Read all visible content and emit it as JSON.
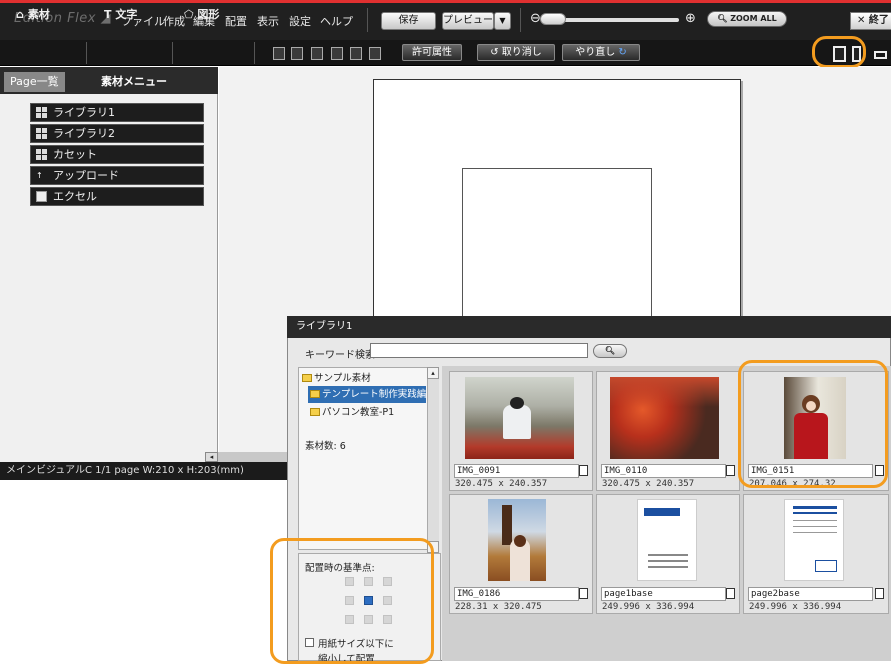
{
  "app": {
    "title": "Edition Flex ◢",
    "menu": [
      "ファイル",
      "作成",
      "編集",
      "配置",
      "表示",
      "設定",
      "ヘルプ"
    ],
    "save_label": "保存",
    "preview_label": "プレビュー",
    "preview_arrow": "▼",
    "zoom_minus": "⊖",
    "zoom_plus": "⊕",
    "zoom_all_label": "ZOOM ALL",
    "close_label": "✕ 終了"
  },
  "toolbar": {
    "sozai_label": "素材",
    "text_label": "文字",
    "shape_label": "図形",
    "permission_label": "許可属性",
    "undo_label": "取り消し",
    "redo_label": "やり直し"
  },
  "left_panel": {
    "tabs": [
      "Page一覧",
      "素材メニュー"
    ],
    "items": [
      "ライブラリ1",
      "ライブラリ2",
      "カセット",
      "アップロード",
      "エクセル"
    ],
    "status": "メインビジュアルC  1/1 page W:210 x H:203(mm)"
  },
  "dialog": {
    "title": "ライブラリ1",
    "keyword_label": "キーワード検索:",
    "keyword_value": "",
    "tree": [
      "サンプル素材",
      "テンプレート制作実践編",
      "パソコン教室-P1"
    ],
    "count_label": "素材数: 6",
    "anchor_label": "配置時の基準点:",
    "fit_label_1": "用紙サイズ以下に",
    "fit_label_2": "縮小して配置",
    "items": [
      {
        "name": "IMG_0091",
        "size": "320.475 x 240.357"
      },
      {
        "name": "IMG_0110",
        "size": "320.475 x 240.357"
      },
      {
        "name": "IMG_0151",
        "size": "207.046 x 274.32"
      },
      {
        "name": "IMG_0186",
        "size": "228.31 x 320.475"
      },
      {
        "name": "page1base",
        "size": "249.996 x 336.994"
      },
      {
        "name": "page2base",
        "size": "249.996 x 336.994"
      }
    ]
  },
  "colors": {
    "highlight": "#f39c1f",
    "selection": "#2f6eb3",
    "accent_red": "#e03030"
  }
}
